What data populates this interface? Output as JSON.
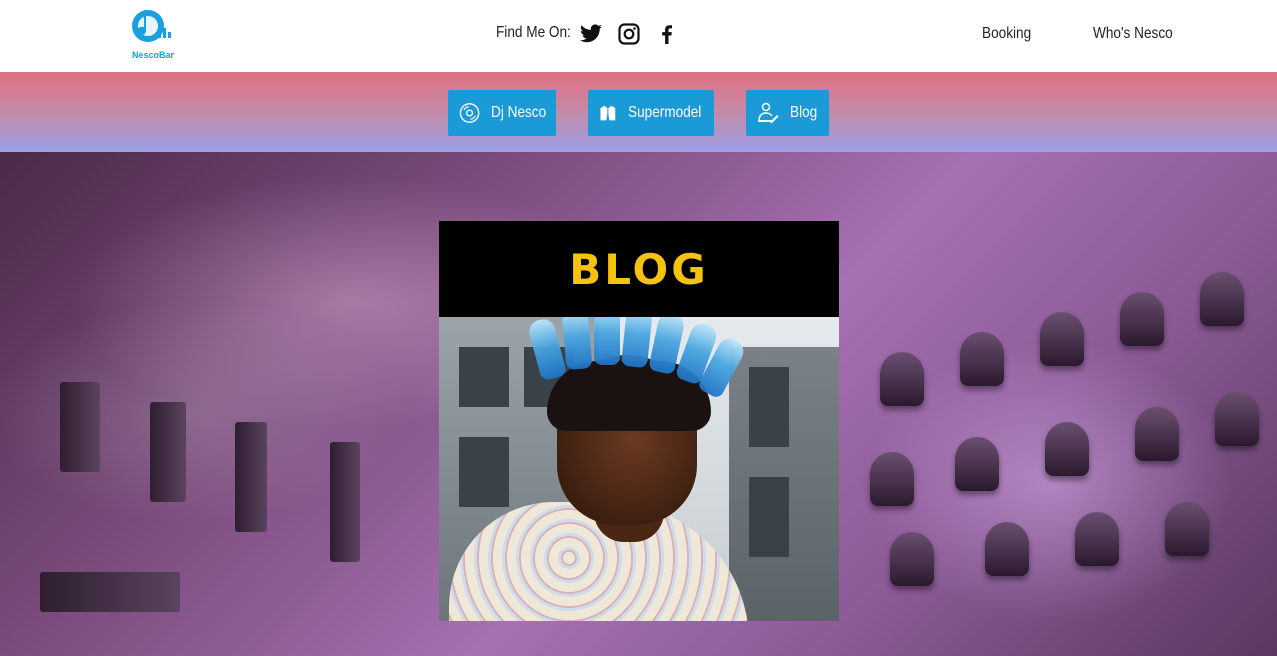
{
  "header": {
    "logo_text": "NescoBar",
    "find_label": "Find Me On:",
    "social": [
      "twitter-icon",
      "instagram-icon",
      "facebook-icon"
    ],
    "nav": [
      {
        "label": "Booking"
      },
      {
        "label": "Who's Nesco"
      }
    ]
  },
  "buttons": [
    {
      "label": "Dj Nesco",
      "icon": "vinyl-icon"
    },
    {
      "label": "Supermodel",
      "icon": "jacket-icon"
    },
    {
      "label": "Blog",
      "icon": "writer-icon"
    }
  ],
  "main": {
    "blog_title": "BLOG"
  },
  "colors": {
    "accent": "#1a9ad6",
    "title": "#f5c20c",
    "logo": "#1aa0e0"
  }
}
